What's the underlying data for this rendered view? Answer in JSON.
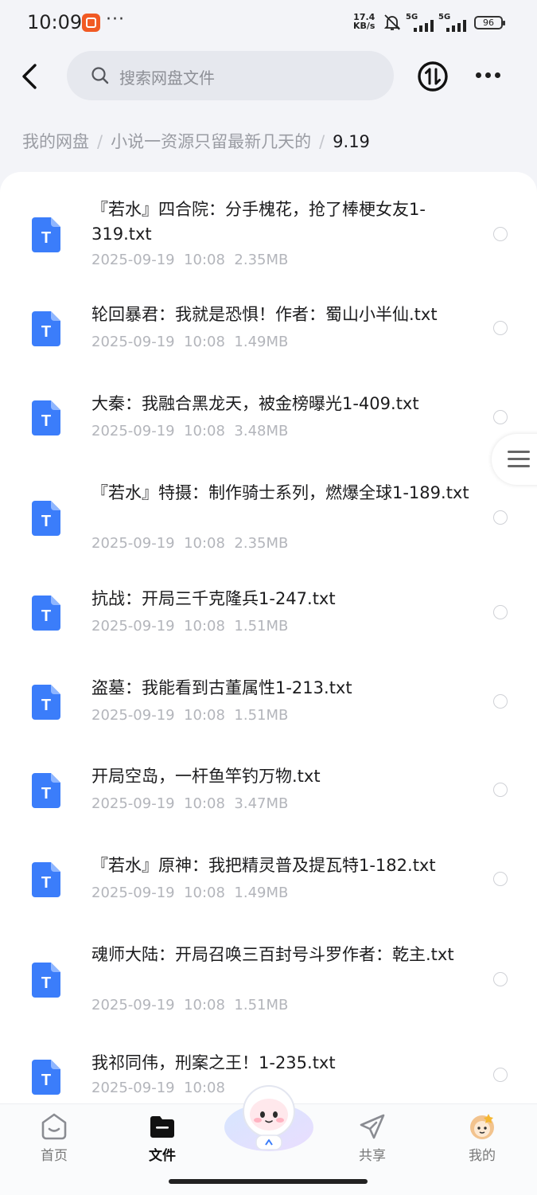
{
  "status_bar": {
    "time": "10:09",
    "net_speed_value": "17.4",
    "net_speed_unit": "KB/s",
    "network_1": "5G",
    "network_2": "5G",
    "battery": "96"
  },
  "header": {
    "search_placeholder": "搜索网盘文件"
  },
  "breadcrumb": {
    "items": [
      "我的网盘",
      "小说一资源只留最新几天的",
      "9.19"
    ],
    "separator": "/"
  },
  "files": [
    {
      "name": "『若水』四合院：分手槐花，抢了棒梗女友1-319.txt",
      "date": "2025-09-19",
      "time": "10:08",
      "size": "2.35MB"
    },
    {
      "name": "轮回暴君：我就是恐惧！作者：蜀山小半仙.txt",
      "date": "2025-09-19",
      "time": "10:08",
      "size": "1.49MB"
    },
    {
      "name": "大秦：我融合黑龙天，被金榜曝光1-409.txt",
      "date": "2025-09-19",
      "time": "10:08",
      "size": "3.48MB"
    },
    {
      "name": "『若水』特摄：制作骑士系列，燃爆全球1-189.txt",
      "date": "2025-09-19",
      "time": "10:08",
      "size": "2.35MB"
    },
    {
      "name": "抗战：开局三千克隆兵1-247.txt",
      "date": "2025-09-19",
      "time": "10:08",
      "size": "1.51MB"
    },
    {
      "name": "盗墓：我能看到古董属性1-213.txt",
      "date": "2025-09-19",
      "time": "10:08",
      "size": "1.51MB"
    },
    {
      "name": "开局空岛，一杆鱼竿钓万物.txt",
      "date": "2025-09-19",
      "time": "10:08",
      "size": "3.47MB"
    },
    {
      "name": "『若水』原神：我把精灵普及提瓦特1-182.txt",
      "date": "2025-09-19",
      "time": "10:08",
      "size": "1.49MB"
    },
    {
      "name": "魂师大陆：开局召唤三百封号斗罗作者：乾主.txt",
      "date": "2025-09-19",
      "time": "10:08",
      "size": "1.51MB"
    },
    {
      "name": "我祁同伟，刑案之王！1-235.txt",
      "date": "2025-09-19",
      "time": "10:08",
      "size": ""
    }
  ],
  "file_type_label": "T",
  "bottom_nav": [
    {
      "label": "首页",
      "icon": "home-icon"
    },
    {
      "label": "文件",
      "icon": "folder-icon",
      "active": true
    },
    {
      "label": "共享",
      "icon": "share-icon"
    },
    {
      "label": "我的",
      "icon": "profile-avatar-icon"
    }
  ],
  "colors": {
    "accent_blue": "#3b7dfa",
    "page_bg": "#f3f4f8",
    "meta_text": "#b3b5bb"
  }
}
